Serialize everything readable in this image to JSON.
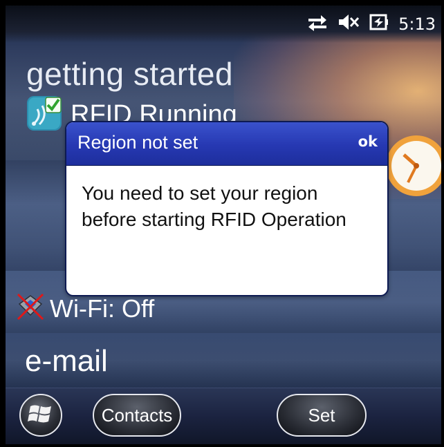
{
  "status_bar": {
    "icons": [
      "connectivity-arrows-icon",
      "speaker-muted-icon",
      "battery-charging-icon"
    ],
    "time": "5:13"
  },
  "home": {
    "title": "getting started",
    "rfid_label": "RFID Running",
    "wifi_label": "Wi-Fi: Off",
    "email_label": "e-mail"
  },
  "dialog": {
    "title": "Region not set",
    "ok_label": "ok",
    "message": "You need to set your region before starting RFID Operation"
  },
  "softkeys": {
    "left_label": "Contacts",
    "right_label": "Set"
  },
  "colors": {
    "dialog_header": "#2638b2",
    "accent_orange": "#f5a040"
  }
}
